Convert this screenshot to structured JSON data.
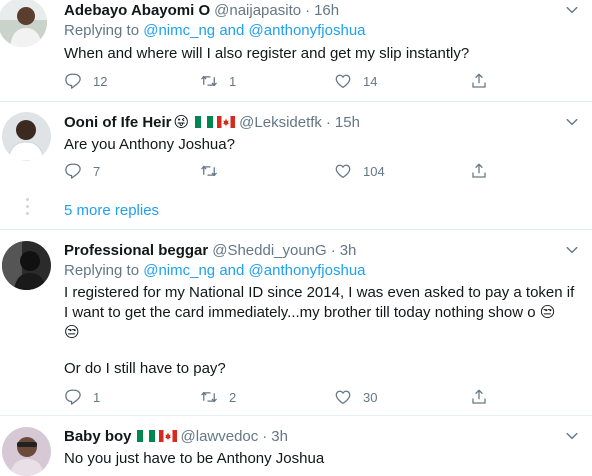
{
  "tweets": [
    {
      "name": "Adebayo Abayomi O",
      "handle": "@naijapasito",
      "separator": "·",
      "time": "16h",
      "replying_prefix": "Replying to",
      "mention1": "@nimc_ng",
      "and": "and",
      "mention2": "@anthonyfjoshua",
      "text": "When and where will I also register and get my slip instantly?",
      "replies": "12",
      "retweets": "1",
      "likes": "14"
    },
    {
      "name": "Ooni of Ife Heir",
      "name_emoji": "😜",
      "handle": "@Leksidetfk",
      "separator": "·",
      "time": "15h",
      "text": "Are you Anthony Joshua?",
      "replies": "7",
      "retweets": "",
      "likes": "104"
    },
    {
      "more_replies": "5 more replies"
    },
    {
      "name": "Professional beggar",
      "handle": "@Sheddi_younG",
      "separator": "·",
      "time": "3h",
      "replying_prefix": "Replying to",
      "mention1": "@nimc_ng",
      "and": "and",
      "mention2": "@anthonyfjoshua",
      "text_line1": "I registered for my National ID since 2014, I was even asked to pay a token if",
      "text_line2": "I want to get the card immediately...my brother till today nothing show o 😒",
      "text_line3": "😒",
      "text_line4": "Or do I still have to pay?",
      "replies": "1",
      "retweets": "2",
      "likes": "30"
    },
    {
      "name": "Baby boy",
      "handle": "@lawvedoc",
      "separator": "·",
      "time": "3h",
      "text": "No you just have to be Anthony Joshua"
    }
  ],
  "colors": {
    "link": "#1da1f2",
    "secondary": "#657786",
    "primary": "#14171a",
    "divider": "#e6ecf0"
  },
  "icons": [
    "reply-icon",
    "retweet-icon",
    "like-icon",
    "share-icon",
    "chevron-down-icon",
    "nigeria-flag-icon",
    "canada-flag-icon"
  ]
}
